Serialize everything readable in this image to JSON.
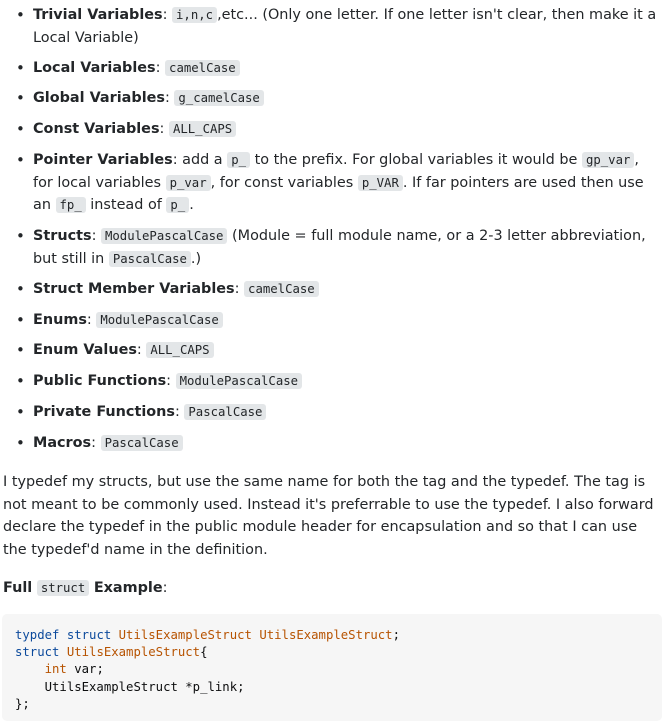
{
  "rules": [
    {
      "title": "Trivial Variables",
      "code": "i,n,c",
      "after": ",etc... (Only one letter. If one letter isn't clear, then make it a Local Variable)"
    },
    {
      "title": "Local Variables",
      "code": "camelCase"
    },
    {
      "title": "Global Variables",
      "code": "g_camelCase"
    },
    {
      "title": "Const Variables",
      "code": "ALL_CAPS"
    },
    {
      "title": "Pointer Variables",
      "t1": ": add a ",
      "c1": "p_",
      "t2": " to the prefix. For global variables it would be ",
      "c2": "gp_var",
      "t3": ", for local variables ",
      "c3": "p_var",
      "t4": ", for const variables ",
      "c4": "p_VAR",
      "t5": ". If far pointers are used then use an ",
      "c5": "fp_",
      "t6": " instead of ",
      "c6": "p_",
      "t7": "."
    },
    {
      "title": "Structs",
      "code": "ModulePascalCase",
      "after": " (Module = full module name, or a 2-3 letter abbreviation, but still in ",
      "code2": "PascalCase",
      "after2": ".)"
    },
    {
      "title": "Struct Member Variables",
      "code": "camelCase"
    },
    {
      "title": "Enums",
      "code": "ModulePascalCase"
    },
    {
      "title": "Enum Values",
      "code": "ALL_CAPS"
    },
    {
      "title": "Public Functions",
      "code": "ModulePascalCase"
    },
    {
      "title": "Private Functions",
      "code": "PascalCase"
    },
    {
      "title": "Macros",
      "code": "PascalCase"
    }
  ],
  "paragraph": "I typedef my structs, but use the same name for both the tag and the typedef. The tag is not meant to be commonly used. Instead it's preferrable to use the typedef. I also forward declare the typedef in the public module header for encapsulation and so that I can use the typedef'd name in the definition.",
  "example_heading": {
    "full": "Full",
    "code": "struct",
    "example": "Example",
    "colon": ":"
  },
  "code_lines": {
    "l1_kw1": "typdef",
    "l1_kw2": "struct",
    "l1_t1": "UtilsExampleStruct",
    "l1_t2": "UtilsExampleStruct",
    "l1_end": ";",
    "l2_kw": "struct",
    "l2_t": "UtilsExampleStruct",
    "l2_end": "{",
    "l3_kw": "int",
    "l3_rest": " var;",
    "l4": "    UtilsExampleStruct *p_link;",
    "l5": "};"
  }
}
